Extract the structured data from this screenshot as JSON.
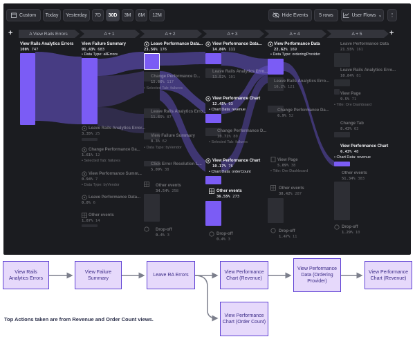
{
  "toolbar": {
    "custom": "Custom",
    "ranges": [
      "Today",
      "Yesterday",
      "7D",
      "30D",
      "3M",
      "6M",
      "12M"
    ],
    "active_range": "30D",
    "hide_events": "Hide Events",
    "rows": "5 rows",
    "view": "User Flows",
    "more": "⋮"
  },
  "columns": [
    "A View Rails Errors",
    "A + 1",
    "A + 2",
    "A + 3",
    "A + 4",
    "A + 5"
  ],
  "nodes": {
    "c0_root": {
      "title": "View Rails Analytics Errors",
      "pct": "100%",
      "count": "747"
    },
    "c1_fs": {
      "title": "View Failure Summary",
      "pct": "91.43%",
      "count": "683",
      "sub": "• Data Type: allErrors"
    },
    "c1_lre": {
      "title": "Leave Rails Analytics Error...",
      "pct": "3.35%",
      "count": "25"
    },
    "c1_cpd": {
      "title": "Change Performance Da...",
      "pct": "1.61%",
      "count": "12",
      "sub": "• Selected Tab: failures"
    },
    "c1_vps": {
      "title": "View Performance Summ...",
      "pct": "0.94%",
      "count": "7",
      "sub": "• Data Type: byVendor"
    },
    "c1_lpd": {
      "title": "Leave Performance Data...",
      "pct": "0.8%",
      "count": "6"
    },
    "c1_oe": {
      "title": "Other events",
      "pct": "1.87%",
      "count": "14"
    },
    "c2_lpd": {
      "title": "Leave Performance Data...",
      "pct": "23.56%",
      "count": "176"
    },
    "c2_cpd": {
      "title": "Change Performance D...",
      "pct": "15.66%",
      "count": "117",
      "sub": "• Selected Tab: failures"
    },
    "c2_lre": {
      "title": "Leave Rails Analytics Erro...",
      "pct": "11.65%",
      "count": "87"
    },
    "c2_vfs": {
      "title": "View Failure Summary",
      "pct": "8.3%",
      "count": "62",
      "sub": "• Data Type: byVendor"
    },
    "c2_cer": {
      "title": "Click Error Resolution L...",
      "pct": "5.09%",
      "count": "38"
    },
    "c2_oe": {
      "title": "Other events",
      "pct": "34.54%",
      "count": "258"
    },
    "c2_do": {
      "title": "Drop-off",
      "pct": "0.4%",
      "count": "3"
    },
    "c3_vpd": {
      "title": "View Performance Data...",
      "pct": "14.86%",
      "count": "111"
    },
    "c3_lre": {
      "title": "Leave Rails Analytics Erro...",
      "pct": "13.52%",
      "count": "101"
    },
    "c3_vpc_rev": {
      "title": "View Performance Chart",
      "pct": "12.45%",
      "count": "93",
      "sub": "• Chart Data: revenue"
    },
    "c3_cpd": {
      "title": "Change Performance D...",
      "pct": "10.71%",
      "count": "80",
      "sub": "• Selected Tab: failures"
    },
    "c3_vpc_oc": {
      "title": "View Performance Chart",
      "pct": "10.17%",
      "count": "76",
      "sub": "• Chart Data: orderCount"
    },
    "c3_oe": {
      "title": "Other events",
      "pct": "36.55%",
      "count": "273"
    },
    "c3_do": {
      "title": "Drop-off",
      "pct": "0.4%",
      "count": "3"
    },
    "c4_vpd": {
      "title": "View Performance Data",
      "pct": "22.62%",
      "count": "169",
      "sub": "• Data Type: orderingProvider"
    },
    "c4_lre": {
      "title": "Leave Rails Analytics Erro...",
      "pct": "16.2%",
      "count": "121"
    },
    "c4_cpd": {
      "title": "Change Performance Da...",
      "pct": "6.9%",
      "count": "52"
    },
    "c4_vp": {
      "title": "View Page",
      "pct": "5.09%",
      "count": "38",
      "sub": "• Title: Ore Dashboard"
    },
    "c4_oe": {
      "title": "Other events",
      "pct": "38.42%",
      "count": "287"
    },
    "c4_do": {
      "title": "Drop-off",
      "pct": "1.47%",
      "count": "11"
    },
    "c5_lpd": {
      "title": "Leave Performance Data",
      "pct": "21.55%",
      "count": "161"
    },
    "c5_lre": {
      "title": "Leave Rails Analytics Erro...",
      "pct": "10.84%",
      "count": "81"
    },
    "c5_vp": {
      "title": "View Page",
      "pct": "9.5%",
      "count": "71",
      "sub": "• Title: Ore Dashboard"
    },
    "c5_ct": {
      "title": "Change Tab",
      "pct": "8.43%",
      "count": "63"
    },
    "c5_vpc": {
      "title": "View Performance Chart",
      "pct": "6.43%",
      "count": "48",
      "sub": "• Chart Data: revenue"
    },
    "c5_oe": {
      "title": "Other events",
      "pct": "51.34%",
      "count": "383"
    },
    "c5_do": {
      "title": "Drop-off",
      "pct": "1.29%",
      "count": "10"
    }
  },
  "flow": {
    "boxes": [
      "View Rails Analytics Errors",
      "View Failure Summary",
      "Leave RA Errors",
      "View Performance Chart (Revenue)",
      "View Performance Data (Ordering Provider)",
      "View Performance Chart (Revenue)",
      "View Performance Chart (Order Count)"
    ],
    "caption": "Top Actions taken are from Revenue and Order Count views."
  },
  "colors": {
    "accent": "#7b5cf5",
    "background": "#1b1c20",
    "flow_box": "#e6d9fb",
    "flow_border": "#5d3fd3"
  }
}
